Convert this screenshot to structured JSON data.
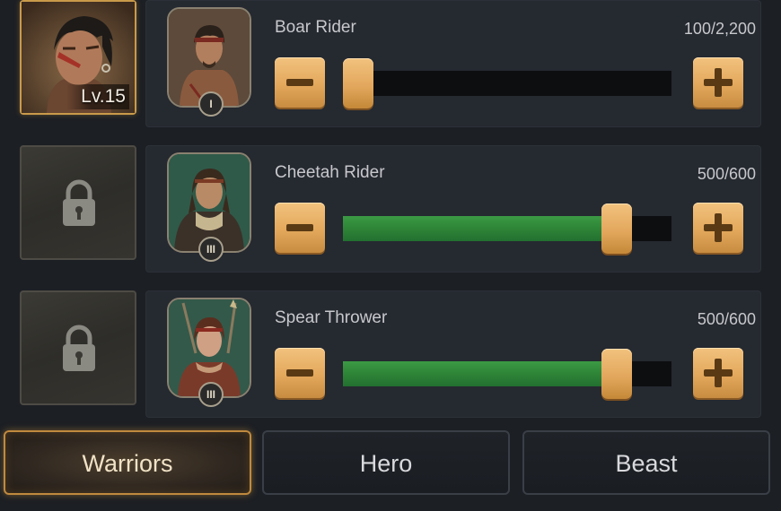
{
  "leader": {
    "level_label": "Lv.15"
  },
  "troops": [
    {
      "name": "Boar Rider",
      "count": "100/2,200",
      "tier": "I",
      "slot": "hero",
      "fill": 0.045,
      "card_bg": "#6b5744"
    },
    {
      "name": "Cheetah Rider",
      "count": "500/600",
      "tier": "III",
      "slot": "locked",
      "fill": 0.833,
      "card_bg": "#2f5a49"
    },
    {
      "name": "Spear Thrower",
      "count": "500/600",
      "tier": "III",
      "slot": "locked",
      "fill": 0.833,
      "card_bg": "#33594a"
    }
  ],
  "tabs": [
    {
      "label": "Warriors",
      "active": true
    },
    {
      "label": "Hero",
      "active": false
    },
    {
      "label": "Beast",
      "active": false
    }
  ],
  "colors": {
    "accent_gold": "#e3a85c",
    "slider_green": "#2e8437",
    "panel": "#252930"
  },
  "icons": {
    "lock": "lock-icon",
    "minus": "minus-icon",
    "plus": "plus-icon",
    "flame": "flame-icon"
  }
}
